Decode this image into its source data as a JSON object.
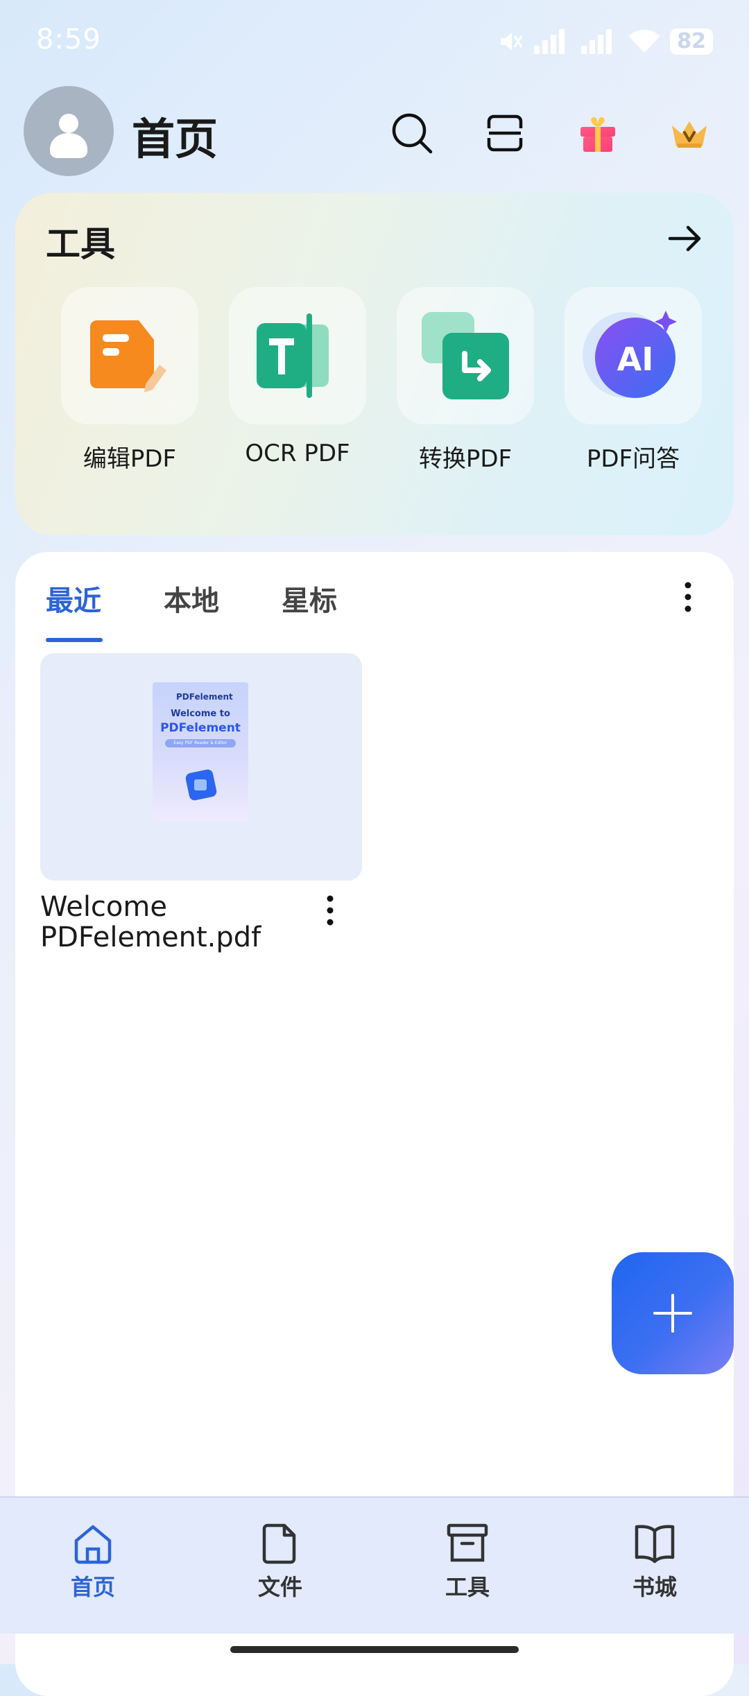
{
  "status_bar": {
    "time": "8:59",
    "battery": "82"
  },
  "header": {
    "title": "首页",
    "icons": [
      "search-icon",
      "scan-icon",
      "gift-icon",
      "crown-icon"
    ]
  },
  "tools": {
    "title": "工具",
    "items": [
      {
        "label": "编辑PDF",
        "icon": "edit-pdf-icon"
      },
      {
        "label": "OCR PDF",
        "icon": "ocr-pdf-icon"
      },
      {
        "label": "转换PDF",
        "icon": "convert-pdf-icon"
      },
      {
        "label": "PDF问答",
        "icon": "ai-pdf-icon"
      }
    ]
  },
  "tabs": [
    {
      "label": "最近",
      "active": true
    },
    {
      "label": "本地",
      "active": false
    },
    {
      "label": "星标",
      "active": false
    }
  ],
  "files": [
    {
      "name_line1": "Welcome",
      "name_line2": "PDFelement.pdf",
      "thumb": {
        "brand": "PDFelement",
        "line1": "Welcome to",
        "line2": "PDFelement",
        "tag": "Easy PDF Reader & Editor"
      }
    }
  ],
  "nav": [
    {
      "label": "首页",
      "active": true
    },
    {
      "label": "文件",
      "active": false
    },
    {
      "label": "工具",
      "active": false
    },
    {
      "label": "书城",
      "active": false
    }
  ],
  "colors": {
    "accent": "#2c64d6",
    "fab": "#1f66f0",
    "edit_orange": "#f68a1f",
    "teal": "#1fae84",
    "ai_purple": "#7a4ff0"
  }
}
